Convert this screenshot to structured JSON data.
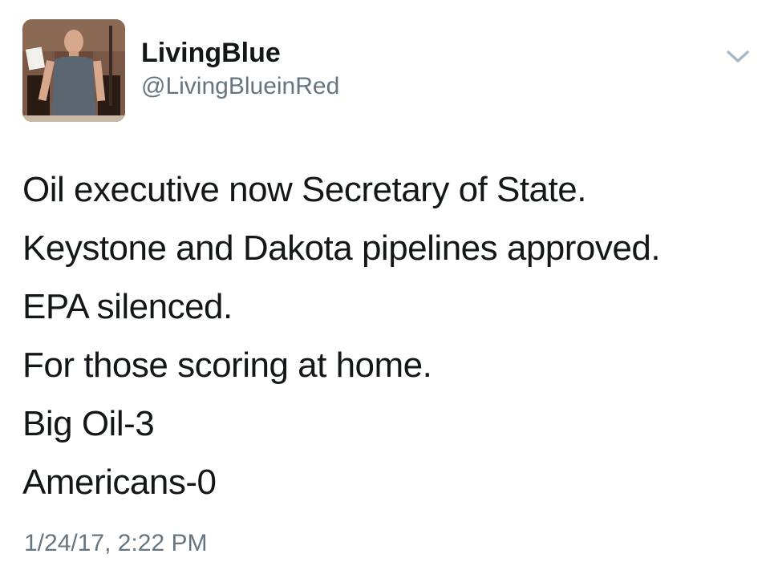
{
  "tweet": {
    "display_name": "LivingBlue",
    "handle": "@LivingBlueinRed",
    "lines": [
      "Oil executive now Secretary of State.",
      "Keystone and Dakota pipelines approved.",
      "EPA silenced.",
      "For those scoring at home.",
      "Big Oil-3",
      "Americans-0"
    ],
    "timestamp": "1/24/17, 2:22 PM"
  },
  "icons": {
    "avatar": "profile-photo",
    "menu": "chevron-down-icon"
  },
  "colors": {
    "text_primary": "#14171a",
    "text_secondary": "#66757f",
    "chevron": "#aab8c2",
    "background": "#ffffff"
  }
}
